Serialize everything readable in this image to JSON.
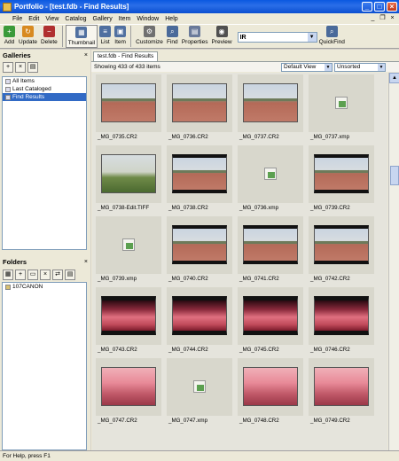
{
  "window": {
    "title": "Portfolio - [test.fdb - Find Results]"
  },
  "menu": [
    "File",
    "Edit",
    "View",
    "Catalog",
    "Gallery",
    "Item",
    "Window",
    "Help"
  ],
  "toolbar": {
    "add": "Add",
    "update": "Update",
    "delete": "Delete",
    "thumbnail": "Thumbnail",
    "list": "List",
    "item": "Item",
    "customize": "Customize",
    "find": "Find",
    "properties": "Properties",
    "preview": "Preview",
    "search_value": "IR",
    "quickfind": "QuickFind"
  },
  "galleries": {
    "header": "Galleries",
    "items": [
      "All Items",
      "Last Cataloged",
      "Find Results"
    ]
  },
  "folders": {
    "header": "Folders",
    "items": [
      "107CANON"
    ]
  },
  "tab": "test.fdb - Find Results",
  "content": {
    "count": "Showing 433 of 433 items",
    "view": "Default View",
    "sort": "Unsorted"
  },
  "thumbnails": [
    "_MG_0735.CR2",
    "_MG_0736.CR2",
    "_MG_0737.CR2",
    "_MG_0737.xmp",
    "_MG_0738-Edit.TIFF",
    "_MG_0738.CR2",
    "_MG_0736.xmp",
    "_MG_0739.CR2",
    "_MG_0739.xmp",
    "_MG_0740.CR2",
    "_MG_0741.CR2",
    "_MG_0742.CR2",
    "_MG_0743.CR2",
    "_MG_0744.CR2",
    "_MG_0745.CR2",
    "_MG_0746.CR2",
    "_MG_0747.CR2",
    "_MG_0747.xmp",
    "_MG_0748.CR2",
    "_MG_0749.CR2"
  ],
  "status": "For Help, press F1"
}
